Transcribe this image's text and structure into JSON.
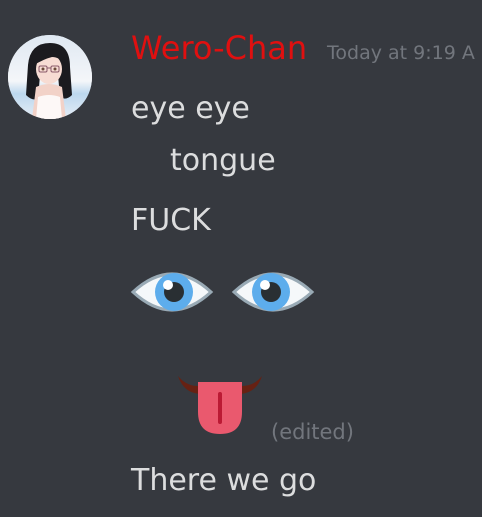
{
  "message": {
    "author": "Wero-Chan",
    "author_color": "#e01010",
    "timestamp": "Today at 9:19 A",
    "lines": [
      "eye eye",
      "tongue",
      "FUCK",
      "There we go"
    ],
    "emoji": [
      "eye-emoji",
      "eye-emoji",
      "tongue-emoji"
    ],
    "edited_label": "(edited)"
  },
  "colors": {
    "background": "#36393f",
    "text": "#dcddde",
    "muted": "#72767d"
  }
}
